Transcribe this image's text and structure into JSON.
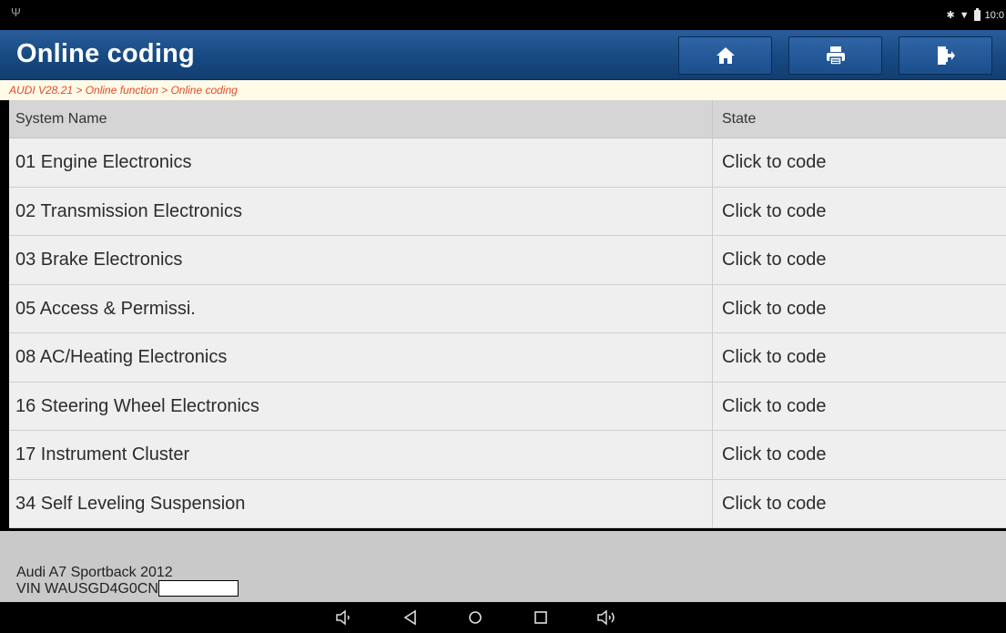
{
  "status": {
    "time": "10:0"
  },
  "header": {
    "title": "Online coding"
  },
  "breadcrumb": "AUDI V28.21 > Online function > Online coding",
  "table": {
    "columns": [
      "System Name",
      "State"
    ],
    "rows": [
      {
        "name": "01 Engine Electronics",
        "state": "Click to code"
      },
      {
        "name": "02 Transmission Electronics",
        "state": "Click to code"
      },
      {
        "name": "03 Brake Electronics",
        "state": "Click to code"
      },
      {
        "name": "05 Access & Permissi.",
        "state": "Click to code"
      },
      {
        "name": "08 AC/Heating Electronics",
        "state": "Click to code"
      },
      {
        "name": "16 Steering Wheel Electronics",
        "state": "Click to code"
      },
      {
        "name": "17 Instrument Cluster",
        "state": "Click to code"
      },
      {
        "name": "34 Self Leveling Suspension",
        "state": "Click to code"
      }
    ]
  },
  "footer": {
    "vehicle": "Audi A7 Sportback 2012",
    "vin": "VIN WAUSGD4G0CN"
  },
  "icons": {
    "status_left": "usb-icon",
    "status_right": [
      "bluetooth-icon",
      "wifi-icon",
      "battery-icon"
    ],
    "toolbar": [
      "home-icon",
      "print-icon",
      "exit-icon"
    ],
    "nav": [
      "volume-down-icon",
      "back-icon",
      "home-circle-icon",
      "recents-icon",
      "volume-up-icon"
    ]
  },
  "colors": {
    "title_bar": "#1c4f8c",
    "breadcrumb_text": "#e4482a",
    "breadcrumb_bg": "#fffbe7"
  }
}
